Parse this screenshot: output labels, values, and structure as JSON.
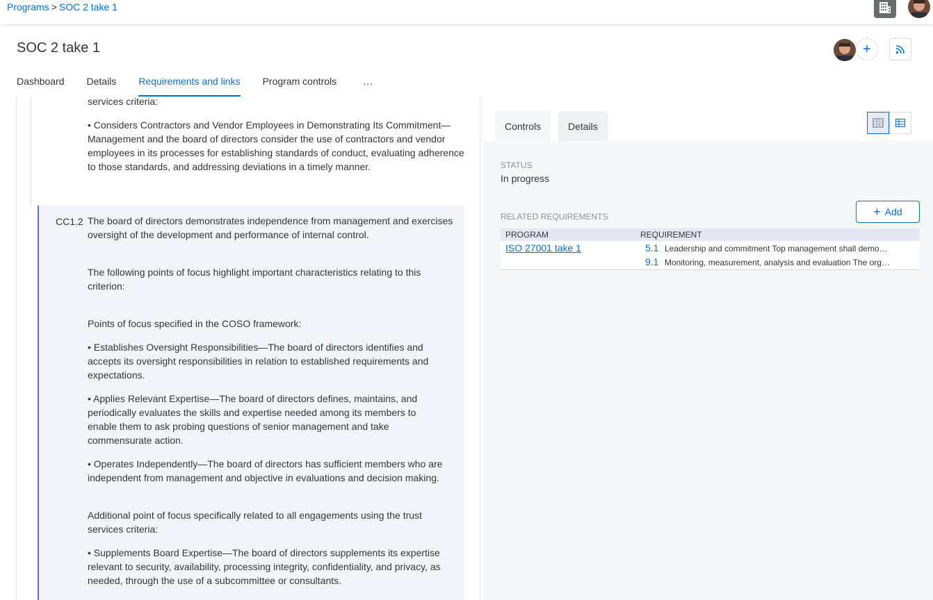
{
  "breadcrumb": {
    "parent": "Programs",
    "separator": ">",
    "current": "SOC 2 take 1"
  },
  "page": {
    "title": "SOC 2 take 1"
  },
  "tabs": [
    {
      "label": "Dashboard"
    },
    {
      "label": "Details"
    },
    {
      "label": "Requirements and links",
      "active": true
    },
    {
      "label": "Program controls"
    },
    {
      "label": "..."
    }
  ],
  "content": {
    "prev_tail": "services criteria:",
    "prev_bullet": "• Considers Contractors and Vendor Employees in Demonstrating Its Commitment—Management and the board of directors consider the use of contractors and vendor employees in its processes for establishing standards of conduct, evaluating adherence to those standards, and addressing deviations in a timely manner.",
    "req_id": "CC1.2",
    "req_text": "The board of directors demonstrates independence from management and exercises oversight of the development and performance of internal control.",
    "para_1": "The following points of focus highlight important characteristics relating to this criterion:",
    "para_2": "Points of focus specified in the COSO framework:",
    "bullet_1": "• Establishes Oversight Responsibilities—The board of directors identifies and accepts its oversight responsibilities in relation to established requirements and expectations.",
    "bullet_2": "• Applies Relevant Expertise—The board of directors defines, maintains, and periodically evaluates the skills and expertise needed among its members to enable them to ask probing questions of senior management and take commensurate action.",
    "bullet_3": "• Operates Independently—The board of directors has sufficient members who are independent from management and objective in evaluations and decision making.",
    "para_3": "Additional point of focus specifically related to all engagements using the trust services criteria:",
    "bullet_4": "• Supplements Board Expertise—The board of directors supplements its expertise relevant to security, availability, processing integrity, confidentiality, and privacy, as needed, through the use of a subcommittee or consultants."
  },
  "detail_panel": {
    "tabs": [
      {
        "label": "Controls"
      },
      {
        "label": "Details",
        "active": true
      }
    ],
    "status_label": "STATUS",
    "status_value": "In progress",
    "related_label": "RELATED REQUIREMENTS",
    "add_label": "Add",
    "table": {
      "col_program": "PROGRAM",
      "col_requirement": "REQUIREMENT",
      "program": "ISO 27001 take 1",
      "rows": [
        {
          "num": "5.1",
          "text": "Leadership and commitment Top management shall demo…"
        },
        {
          "num": "9.1",
          "text": "Monitoring, measurement, analysis and evaluation The org…"
        }
      ]
    }
  },
  "colors": {
    "accent": "#0a6ed1",
    "highlight_bg": "#f3f4f9",
    "highlight_border": "#5d73c5"
  },
  "icons": [
    "building-icon",
    "user-avatar",
    "plus-icon",
    "rss-icon",
    "grid-view-icon",
    "table-view-icon"
  ]
}
